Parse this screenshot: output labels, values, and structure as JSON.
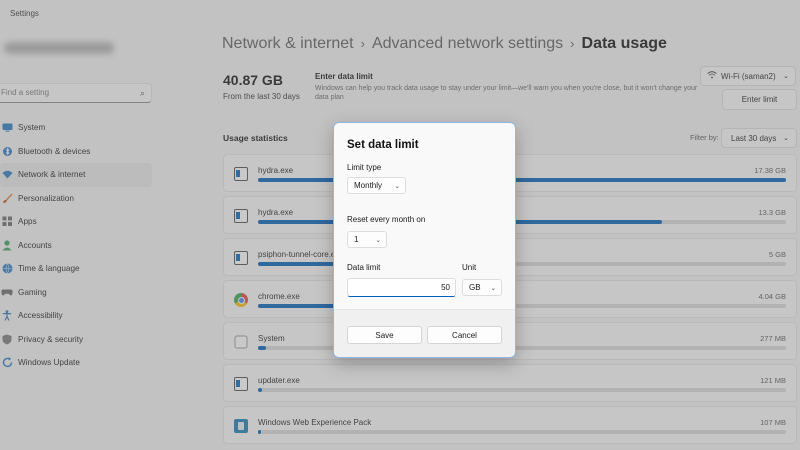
{
  "window": {
    "title": "Settings"
  },
  "search": {
    "placeholder": "Find a setting"
  },
  "sidebar": {
    "items": [
      {
        "label": "System",
        "icon": "monitor-icon"
      },
      {
        "label": "Bluetooth & devices",
        "icon": "bluetooth-icon"
      },
      {
        "label": "Network & internet",
        "icon": "wifi-icon",
        "active": true
      },
      {
        "label": "Personalization",
        "icon": "brush-icon"
      },
      {
        "label": "Apps",
        "icon": "apps-icon"
      },
      {
        "label": "Accounts",
        "icon": "person-icon"
      },
      {
        "label": "Time & language",
        "icon": "globe-icon"
      },
      {
        "label": "Gaming",
        "icon": "gamepad-icon"
      },
      {
        "label": "Accessibility",
        "icon": "accessibility-icon"
      },
      {
        "label": "Privacy & security",
        "icon": "shield-icon"
      },
      {
        "label": "Windows Update",
        "icon": "update-icon"
      }
    ]
  },
  "breadcrumb": {
    "items": [
      "Network & internet",
      "Advanced network settings"
    ],
    "current": "Data usage",
    "separator": "›"
  },
  "usage": {
    "total": "40.87 GB",
    "period": "From the last 30 days"
  },
  "limit_info": {
    "title": "Enter data limit",
    "description": "Windows can help you track data usage to stay under your limit—we'll warn you when you're close, but it won't change your data plan"
  },
  "network_select": {
    "value": "Wi-Fi (saman2)"
  },
  "enter_limit_button": {
    "label": "Enter limit"
  },
  "stats": {
    "title": "Usage statistics",
    "filter_label": "Filter by:",
    "filter_value": "Last 30 days",
    "rows": [
      {
        "name": "hydra.exe",
        "amount": "17.38 GB",
        "fraction": 1.0,
        "icon": "app-window-icon"
      },
      {
        "name": "hydra.exe",
        "amount": "13.3 GB",
        "fraction": 0.765,
        "icon": "app-window-icon"
      },
      {
        "name": "psiphon-tunnel-core.exe",
        "amount": "5 GB",
        "fraction": 0.29,
        "icon": "app-window-icon"
      },
      {
        "name": "chrome.exe",
        "amount": "4.04 GB",
        "fraction": 0.233,
        "icon": "chrome-icon"
      },
      {
        "name": "System",
        "amount": "277 MB",
        "fraction": 0.016,
        "icon": "system-icon"
      },
      {
        "name": "updater.exe",
        "amount": "121 MB",
        "fraction": 0.007,
        "icon": "app-window-icon"
      },
      {
        "name": "Windows Web Experience Pack",
        "amount": "107 MB",
        "fraction": 0.006,
        "icon": "widgets-icon"
      }
    ]
  },
  "dialog": {
    "title": "Set data limit",
    "limit_type_label": "Limit type",
    "limit_type_value": "Monthly",
    "reset_label": "Reset every month on",
    "reset_value": "1",
    "data_limit_label": "Data limit",
    "data_limit_value": "50",
    "unit_label": "Unit",
    "unit_value": "GB",
    "save_label": "Save",
    "cancel_label": "Cancel"
  },
  "colors": {
    "accent": "#005fb8",
    "dialog_border": "#8fb7df",
    "overlay": "rgba(120,120,120,0.40)"
  }
}
